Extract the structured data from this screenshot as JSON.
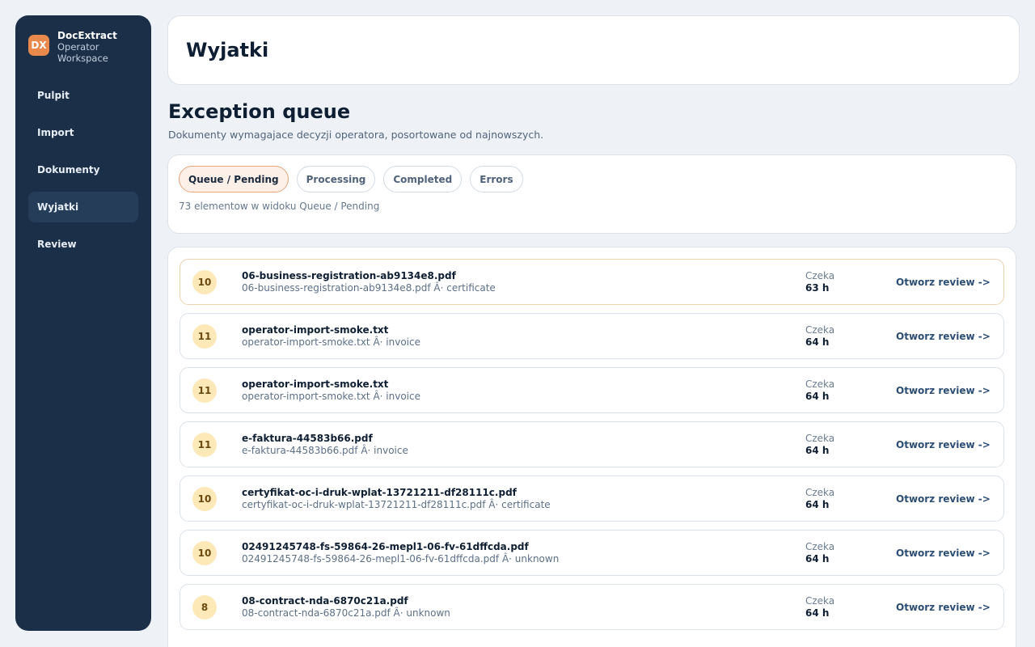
{
  "sidebar": {
    "logo": "DX",
    "brand_name": "DocExtract",
    "brand_sub": "Operator Workspace",
    "items": [
      {
        "label": "Pulpit"
      },
      {
        "label": "Import"
      },
      {
        "label": "Dokumenty"
      },
      {
        "label": "Wyjatki"
      },
      {
        "label": "Review"
      }
    ],
    "active_item": "Wyjatki"
  },
  "header": {
    "title": "Wyjatki"
  },
  "section": {
    "title": "Exception queue",
    "subtitle": "Dokumenty wymagajace decyzji operatora, posortowane od najnowszych."
  },
  "filters": {
    "tabs": [
      {
        "label": "Queue / Pending"
      },
      {
        "label": "Processing"
      },
      {
        "label": "Completed"
      },
      {
        "label": "Errors"
      }
    ],
    "active_tab": "Queue / Pending",
    "count_text": "73 elementow w widoku Queue / Pending"
  },
  "queue": {
    "wait_label": "Czeka",
    "review_label": "Otworz review ->",
    "items": [
      {
        "priority": "10",
        "name": "06-business-registration-ab9134e8.pdf",
        "meta": "06-business-registration-ab9134e8.pdf Â· certificate",
        "wait": "63 h"
      },
      {
        "priority": "11",
        "name": "operator-import-smoke.txt",
        "meta": "operator-import-smoke.txt Â· invoice",
        "wait": "64 h"
      },
      {
        "priority": "11",
        "name": "operator-import-smoke.txt",
        "meta": "operator-import-smoke.txt Â· invoice",
        "wait": "64 h"
      },
      {
        "priority": "11",
        "name": "e-faktura-44583b66.pdf",
        "meta": "e-faktura-44583b66.pdf Â· invoice",
        "wait": "64 h"
      },
      {
        "priority": "10",
        "name": "certyfikat-oc-i-druk-wplat-13721211-df28111c.pdf",
        "meta": "certyfikat-oc-i-druk-wplat-13721211-df28111c.pdf Â· certificate",
        "wait": "64 h"
      },
      {
        "priority": "10",
        "name": "02491245748-fs-59864-26-mepl1-06-fv-61dffcda.pdf",
        "meta": "02491245748-fs-59864-26-mepl1-06-fv-61dffcda.pdf Â· unknown",
        "wait": "64 h"
      },
      {
        "priority": "8",
        "name": "08-contract-nda-6870c21a.pdf",
        "meta": "08-contract-nda-6870c21a.pdf Â· unknown",
        "wait": "64 h"
      }
    ]
  },
  "colors": {
    "sidebar_bg": "#1b2f48",
    "accent": "#e98a4c",
    "priority_badge": "#fde8b8",
    "link": "#2d4e74"
  }
}
